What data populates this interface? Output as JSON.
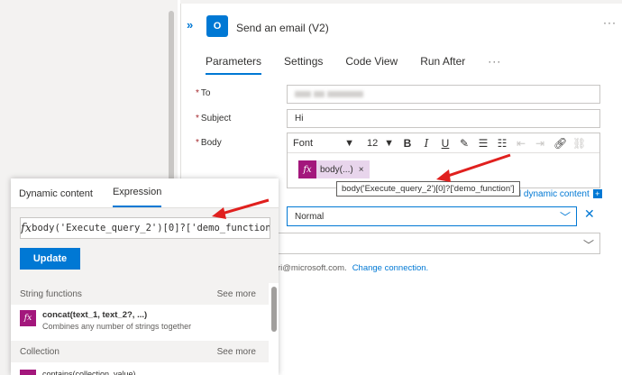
{
  "action": {
    "title": "Send an email (V2)",
    "icon": "outlook-icon",
    "tabs": [
      "Parameters",
      "Settings",
      "Code View",
      "Run After"
    ],
    "more": "···"
  },
  "fields": {
    "to_label": "To",
    "subject_label": "Subject",
    "subject_value": "Hi",
    "body_label": "Body",
    "required_mark": "*"
  },
  "toolbar": {
    "font": "Font",
    "size": "12",
    "bold": "B",
    "italic": "I",
    "underline": "U"
  },
  "body_token": {
    "icon": "fx",
    "label": "body(...)",
    "remove": "×"
  },
  "tooltip": "body('Execute_query_2')[0]?['demo_function']",
  "add_dynamic": "dd dynamic content",
  "importance": {
    "value": "Normal",
    "clear": "✕"
  },
  "connection": {
    "text": "ri@microsoft.com.",
    "link": "Change connection."
  },
  "panel": {
    "tabs": [
      "Dynamic content",
      "Expression"
    ],
    "active_tab": "Expression",
    "fx": "fx",
    "expression": "body('Execute_query_2')[0]?['demo_function']",
    "update": "Update",
    "sections": [
      {
        "title": "String functions",
        "see_more": "See more"
      },
      {
        "title": "Collection",
        "see_more": "See more"
      }
    ],
    "functions": [
      {
        "name": "concat(text_1, text_2?, ...)",
        "desc": "Combines any number of strings together"
      }
    ],
    "partial_item": "contains(collection, value)"
  },
  "colors": {
    "accent": "#0078d4",
    "expression_token": "#a3177c",
    "token_bg": "#e8d5ec",
    "annotation_arrow": "#e0201e"
  }
}
